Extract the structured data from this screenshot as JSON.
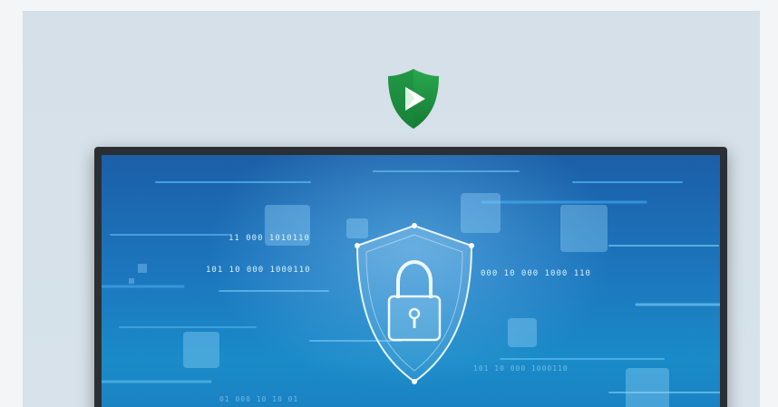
{
  "illustration": {
    "code_lines": [
      "11 000 1010110",
      "101 10 000 1000110",
      "000 10 000 1000 110",
      "101 10 000 1000110",
      "01 000 10 10 01"
    ]
  },
  "colors": {
    "page_background": "#f3f5f7",
    "panel_background": "#d5e0e8",
    "monitor_frame": "#2b2f33",
    "screen_blue": "#1c77be",
    "logo_green": "#1f8f3f",
    "shield_outline": "#e6f4ff"
  },
  "icons": {
    "logo": "play-protect-shield-icon",
    "center": "padlock-shield-icon"
  }
}
